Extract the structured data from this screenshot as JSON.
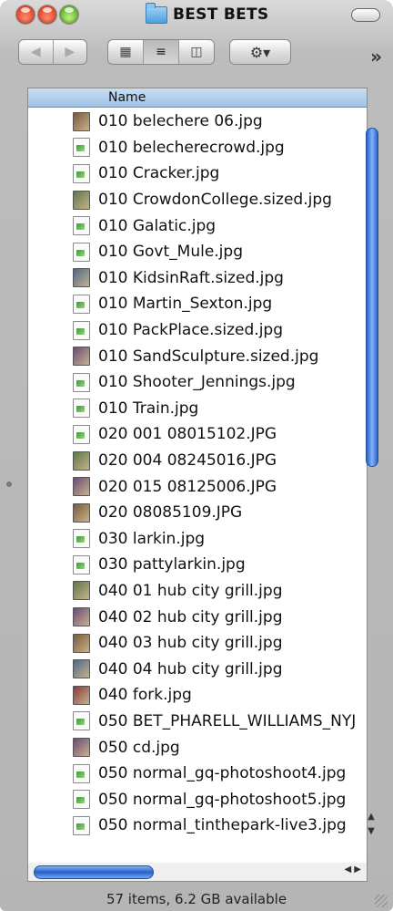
{
  "window": {
    "title": "BEST BETS",
    "status_text": "57 items, 6.2 GB available"
  },
  "toolbar": {
    "nav_back_icon": "back-arrow",
    "nav_forward_icon": "forward-arrow",
    "views": [
      "icon-view",
      "list-view",
      "column-view"
    ],
    "selected_view": "list-view",
    "action_icon": "gear-icon",
    "overflow_label": "»"
  },
  "list": {
    "column_header": "Name",
    "files": [
      {
        "name": "010 belechere 06.jpg",
        "icon": "thumb"
      },
      {
        "name": "010 belecherecrowd.jpg",
        "icon": "doc"
      },
      {
        "name": "010 Cracker.jpg",
        "icon": "doc"
      },
      {
        "name": "010 CrowdonCollege.sized.jpg",
        "icon": "thumb"
      },
      {
        "name": "010 Galatic.jpg",
        "icon": "doc"
      },
      {
        "name": "010 Govt_Mule.jpg",
        "icon": "doc"
      },
      {
        "name": "010 KidsinRaft.sized.jpg",
        "icon": "thumb"
      },
      {
        "name": "010 Martin_Sexton.jpg",
        "icon": "doc"
      },
      {
        "name": "010 PackPlace.sized.jpg",
        "icon": "doc"
      },
      {
        "name": "010 SandSculpture.sized.jpg",
        "icon": "thumb"
      },
      {
        "name": "010 Shooter_Jennings.jpg",
        "icon": "doc"
      },
      {
        "name": "010 Train.jpg",
        "icon": "doc"
      },
      {
        "name": "020 001 08015102.JPG",
        "icon": "doc"
      },
      {
        "name": "020 004 08245016.JPG",
        "icon": "thumb"
      },
      {
        "name": "020 015 08125006.JPG",
        "icon": "thumb"
      },
      {
        "name": "020 08085109.JPG",
        "icon": "thumb"
      },
      {
        "name": "030 larkin.jpg",
        "icon": "doc"
      },
      {
        "name": "030 pattylarkin.jpg",
        "icon": "doc"
      },
      {
        "name": "040 01 hub city grill.jpg",
        "icon": "thumb"
      },
      {
        "name": "040 02 hub city grill.jpg",
        "icon": "thumb"
      },
      {
        "name": "040 03 hub city grill.jpg",
        "icon": "thumb"
      },
      {
        "name": "040 04 hub city grill.jpg",
        "icon": "thumb"
      },
      {
        "name": "040 fork.jpg",
        "icon": "thumb"
      },
      {
        "name": "050 BET_PHARELL_WILLIAMS_NYJ",
        "icon": "doc"
      },
      {
        "name": "050 cd.jpg",
        "icon": "thumb"
      },
      {
        "name": "050 normal_gq-photoshoot4.jpg",
        "icon": "doc"
      },
      {
        "name": "050 normal_gq-photoshoot5.jpg",
        "icon": "doc"
      },
      {
        "name": "050 normal_tinthepark-live3.jpg",
        "icon": "doc"
      }
    ]
  },
  "colors": {
    "header_bg": "#b3d0ee",
    "scroll_thumb": "#3f78d6"
  }
}
